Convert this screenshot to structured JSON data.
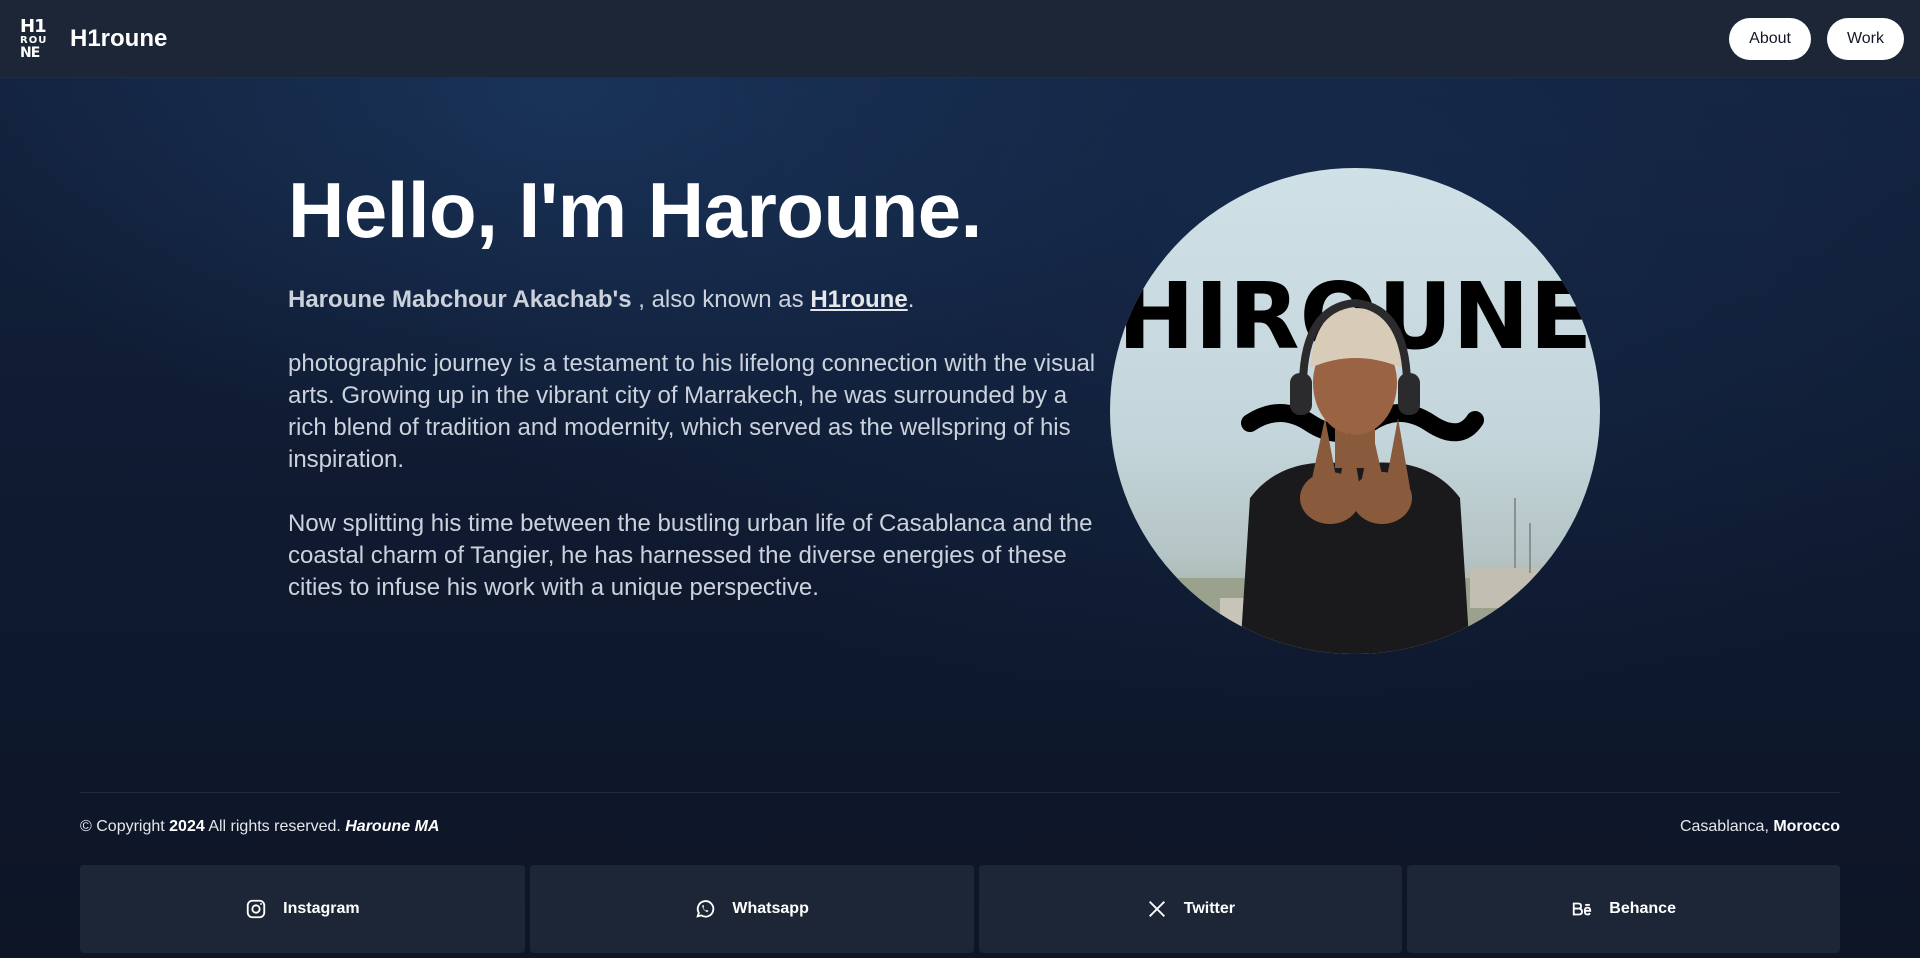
{
  "header": {
    "logo_lines": [
      "H1",
      "ROU",
      "NE"
    ],
    "brand": "H1roune",
    "nav": [
      {
        "label": "About"
      },
      {
        "label": "Work"
      }
    ]
  },
  "hero": {
    "title": "Hello, I'm Haroune.",
    "intro": {
      "fullname": "Haroune Mabchour Akachab's",
      "middle": " , also known as ",
      "alias": "H1roune",
      "end": "."
    },
    "paragraph1": "photographic journey is a testament to his lifelong connection with the visual arts. Growing up in the vibrant city of Marrakech, he was surrounded by a rich blend of tradition and modernity, which served as the wellspring of his inspiration.",
    "paragraph2": "Now splitting his time between the bustling urban life of Casablanca and the coastal charm of Tangier, he has harnessed the diverse energies of these cities to infuse his work with a unique perspective.",
    "portrait_text": "HIROUNE"
  },
  "footer": {
    "copyright_prefix": "© Copyright ",
    "year": "2024",
    "rights": " All rights reserved. ",
    "owner": "Haroune MA",
    "location_city": "Casablanca, ",
    "location_country": "Morocco",
    "socials": [
      {
        "label": "Instagram",
        "icon": "instagram-icon"
      },
      {
        "label": "Whatsapp",
        "icon": "whatsapp-icon"
      },
      {
        "label": "Twitter",
        "icon": "x-icon"
      },
      {
        "label": "Behance",
        "icon": "behance-icon"
      }
    ]
  }
}
